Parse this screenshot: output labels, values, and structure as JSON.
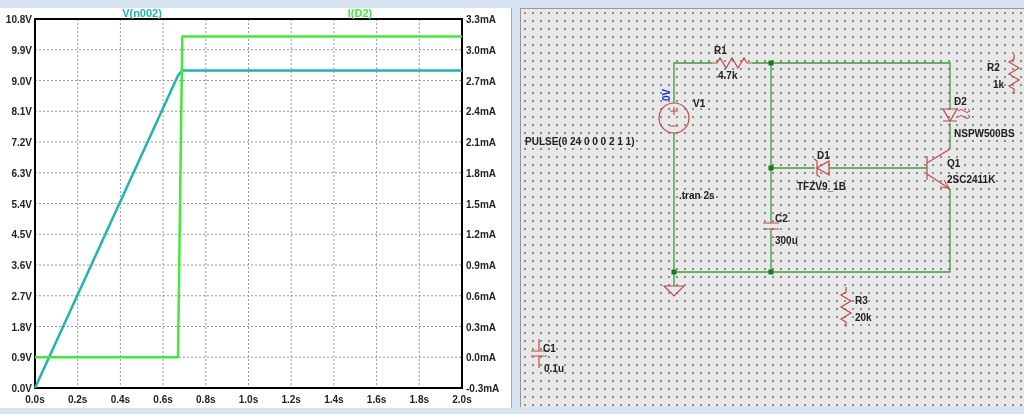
{
  "plot": {
    "chart_data": {
      "type": "line",
      "grid": true,
      "x": [
        0,
        0.67,
        0.69,
        2.0
      ],
      "xlim": [
        0,
        2
      ],
      "ylim": [
        0,
        10.8
      ],
      "y2lim": [
        -0.3,
        3.3
      ],
      "xticks": [
        {
          "value": 0,
          "label": "0.0s"
        },
        {
          "value": 0.2,
          "label": "0.2s"
        },
        {
          "value": 0.4,
          "label": "0.4s"
        },
        {
          "value": 0.6,
          "label": "0.6s"
        },
        {
          "value": 0.8,
          "label": "0.8s"
        },
        {
          "value": 1.0,
          "label": "1.0s"
        },
        {
          "value": 1.2,
          "label": "1.2s"
        },
        {
          "value": 1.4,
          "label": "1.4s"
        },
        {
          "value": 1.6,
          "label": "1.6s"
        },
        {
          "value": 1.8,
          "label": "1.8s"
        },
        {
          "value": 2.0,
          "label": "2.0s"
        }
      ],
      "yticks": [
        {
          "value": 0,
          "label": "0.0V"
        },
        {
          "value": 0.9,
          "label": "0.9V"
        },
        {
          "value": 1.8,
          "label": "1.8V"
        },
        {
          "value": 2.7,
          "label": "2.7V"
        },
        {
          "value": 3.6,
          "label": "3.6V"
        },
        {
          "value": 4.5,
          "label": "4.5V"
        },
        {
          "value": 5.4,
          "label": "5.4V"
        },
        {
          "value": 6.3,
          "label": "6.3V"
        },
        {
          "value": 7.2,
          "label": "7.2V"
        },
        {
          "value": 8.1,
          "label": "8.1V"
        },
        {
          "value": 9.0,
          "label": "9.0V"
        },
        {
          "value": 9.9,
          "label": "9.9V"
        },
        {
          "value": 10.8,
          "label": "10.8V"
        }
      ],
      "y2ticks": [
        {
          "value": -0.3,
          "label": "-0.3mA"
        },
        {
          "value": 0,
          "label": "0.0mA"
        },
        {
          "value": 0.3,
          "label": "0.3mA"
        },
        {
          "value": 0.6,
          "label": "0.6mA"
        },
        {
          "value": 0.9,
          "label": "0.9mA"
        },
        {
          "value": 1.2,
          "label": "1.2mA"
        },
        {
          "value": 1.5,
          "label": "1.5mA"
        },
        {
          "value": 1.8,
          "label": "1.8mA"
        },
        {
          "value": 2.1,
          "label": "2.1mA"
        },
        {
          "value": 2.4,
          "label": "2.4mA"
        },
        {
          "value": 2.7,
          "label": "2.7mA"
        },
        {
          "value": 3.0,
          "label": "3.0mA"
        },
        {
          "value": 3.3,
          "label": "3.3mA"
        }
      ],
      "series": [
        {
          "name": "V(n002)",
          "color": "#22b3b0",
          "values": [
            0,
            9.15,
            9.29,
            9.29
          ]
        },
        {
          "name": "I(D2)",
          "color": "#44e83c",
          "axis": "y2",
          "values": [
            0,
            0,
            3.13,
            3.13
          ]
        }
      ]
    }
  },
  "schematic": {
    "components": [
      {
        "kind": "resistor",
        "name": "R1",
        "value": "4.7k"
      },
      {
        "kind": "voltage_source",
        "name": "V1",
        "value": "PULSE(0 24 0 0 0 2 1 1)",
        "node_voltage": "0V"
      },
      {
        "kind": "resistor",
        "name": "R2",
        "value": "1k"
      },
      {
        "kind": "led",
        "name": "D2",
        "value": "NSPW500BS"
      },
      {
        "kind": "zener",
        "name": "D1",
        "value": "TFZV9_1B"
      },
      {
        "kind": "npn",
        "name": "Q1",
        "value": "2SC2411K"
      },
      {
        "kind": "capacitor",
        "name": "C2",
        "value": "300u"
      },
      {
        "kind": "resistor",
        "name": "R3",
        "value": "20k"
      },
      {
        "kind": "capacitor",
        "name": "C1",
        "value": "0.1u"
      }
    ],
    "directive": ".tran 2s"
  }
}
